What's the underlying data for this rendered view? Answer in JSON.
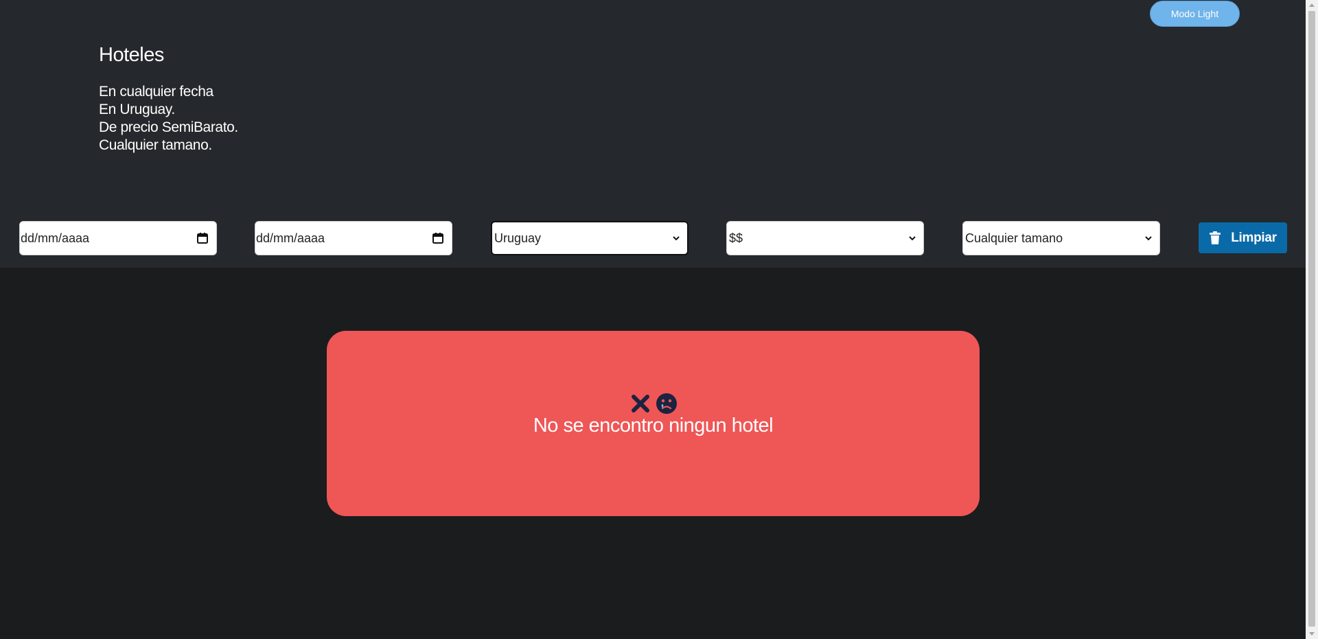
{
  "header": {
    "mode_button": "Modo Light",
    "title": "Hoteles",
    "lines": [
      "En cualquier fecha",
      "En Uruguay.",
      "De precio SemiBarato.",
      "Cualquier tamano."
    ]
  },
  "filters": {
    "date_from": {
      "value": "dd/mm/aaaa",
      "icon": "calendar-icon"
    },
    "date_to": {
      "value": "dd/mm/aaaa",
      "icon": "calendar-icon"
    },
    "country": {
      "selected": "Uruguay"
    },
    "price": {
      "selected": "$$"
    },
    "size": {
      "selected": "Cualquier tamano"
    },
    "clear_button": {
      "label": "Limpiar",
      "icon": "trash-icon"
    }
  },
  "empty_state": {
    "message": "No se encontro ningun hotel",
    "icons": [
      "close-icon",
      "sad-face-icon"
    ]
  },
  "colors": {
    "header_bg": "#25282c",
    "page_bg": "#1b1c1e",
    "mode_button": "#6fb4ea",
    "clear_button": "#0a6aa8",
    "empty_card": "#ef5656",
    "icon_dark": "#1c2340"
  }
}
